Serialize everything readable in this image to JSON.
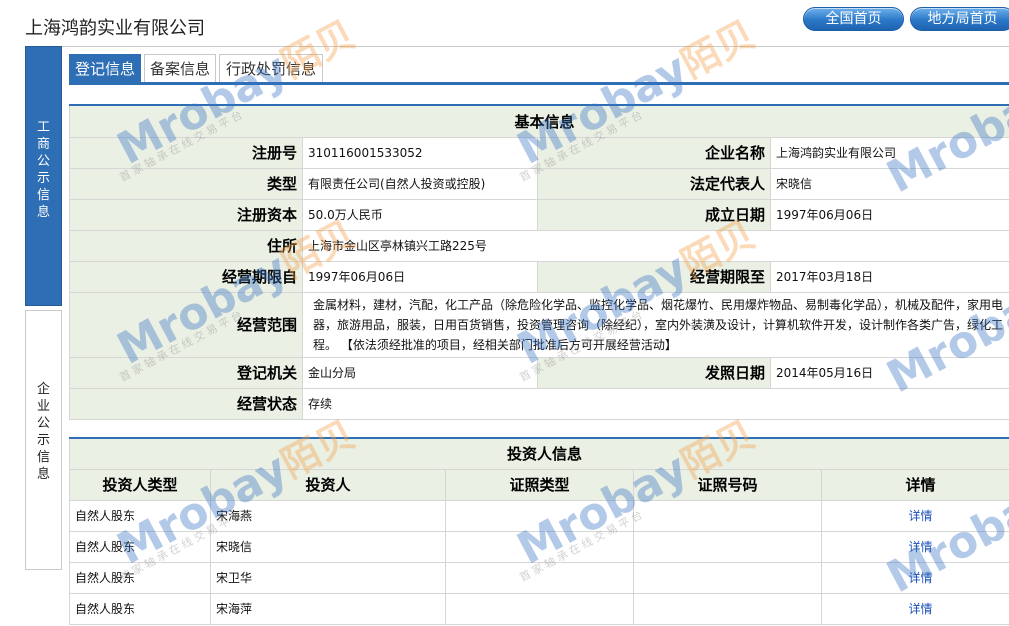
{
  "company_name": "上海鸿韵实业有限公司",
  "top_buttons": {
    "national": "全国首页",
    "local": "地方局首页"
  },
  "sidebar": {
    "gongshang": "工商公示信息",
    "qiye": "企业公示信息"
  },
  "tabs": [
    "登记信息",
    "备案信息",
    "行政处罚信息"
  ],
  "basic": {
    "title": "基本信息",
    "rows": {
      "reg_no": {
        "label": "注册号",
        "value": "310116001533052"
      },
      "company": {
        "label": "企业名称",
        "value": "上海鸿韵实业有限公司"
      },
      "type": {
        "label": "类型",
        "value": "有限责任公司(自然人投资或控股)"
      },
      "legal_rep": {
        "label": "法定代表人",
        "value": "宋晓信"
      },
      "capital": {
        "label": "注册资本",
        "value": "50.0万人民币"
      },
      "est_date": {
        "label": "成立日期",
        "value": "1997年06月06日"
      },
      "address": {
        "label": "住所",
        "value": "上海市金山区亭林镇兴工路225号"
      },
      "term_from": {
        "label": "经营期限自",
        "value": "1997年06月06日"
      },
      "term_to": {
        "label": "经营期限至",
        "value": "2017年03月18日"
      },
      "scope": {
        "label": "经营范围",
        "value": "金属材料，建材，汽配，化工产品（除危险化学品、监控化学品、烟花爆竹、民用爆炸物品、易制毒化学品），机械及配件，家用电器，旅游用品，服装，日用百货销售，投资管理咨询（除经纪），室内外装潢及设计，计算机软件开发，设计制作各类广告，绿化工程。 【依法须经批准的项目，经相关部门批准后方可开展经营活动】"
      },
      "authority": {
        "label": "登记机关",
        "value": "金山分局"
      },
      "issue_date": {
        "label": "发照日期",
        "value": "2014年05月16日"
      },
      "status": {
        "label": "经营状态",
        "value": "存续"
      }
    }
  },
  "investors": {
    "title": "投资人信息",
    "headers": [
      "投资人类型",
      "投资人",
      "证照类型",
      "证照号码",
      "详情"
    ],
    "rows": [
      {
        "type": "自然人股东",
        "name": "宋海燕",
        "id_type": "",
        "id_no": "",
        "detail": "详情"
      },
      {
        "type": "自然人股东",
        "name": "宋晓信",
        "id_type": "",
        "id_no": "",
        "detail": "详情"
      },
      {
        "type": "自然人股东",
        "name": "宋卫华",
        "id_type": "",
        "id_no": "",
        "detail": "详情"
      },
      {
        "type": "自然人股东",
        "name": "宋海萍",
        "id_type": "",
        "id_no": "",
        "detail": "详情"
      }
    ]
  },
  "watermark": {
    "brand": "Mrobay",
    "brand_cn": "陌贝",
    "slogan": "首家轴承在线交易平台"
  },
  "colors": {
    "accent": "#2e6eb5",
    "label_bg": "#eaf0e4",
    "link": "#1a4fb8",
    "wm_orange": "#f2a04a"
  }
}
